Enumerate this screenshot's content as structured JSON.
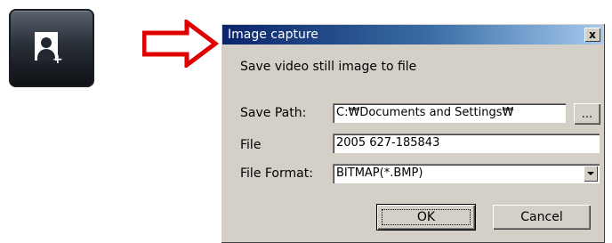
{
  "toolbar": {
    "capture_icon": "image-capture-icon"
  },
  "arrow": {
    "color": "#e00000",
    "icon": "right-arrow-icon"
  },
  "dialog": {
    "title": "Image capture",
    "close_label": "x",
    "description": "Save video still image to file",
    "save_path_label": "Save Path:",
    "save_path_value": "C:₩Documents and Settings₩",
    "browse_label": "...",
    "file_label": "File",
    "file_value": "2005 627-185843",
    "file_format_label": "File Format:",
    "file_format_value": "BITMAP(*.BMP)",
    "ok_label": "OK",
    "cancel_label": "Cancel"
  }
}
